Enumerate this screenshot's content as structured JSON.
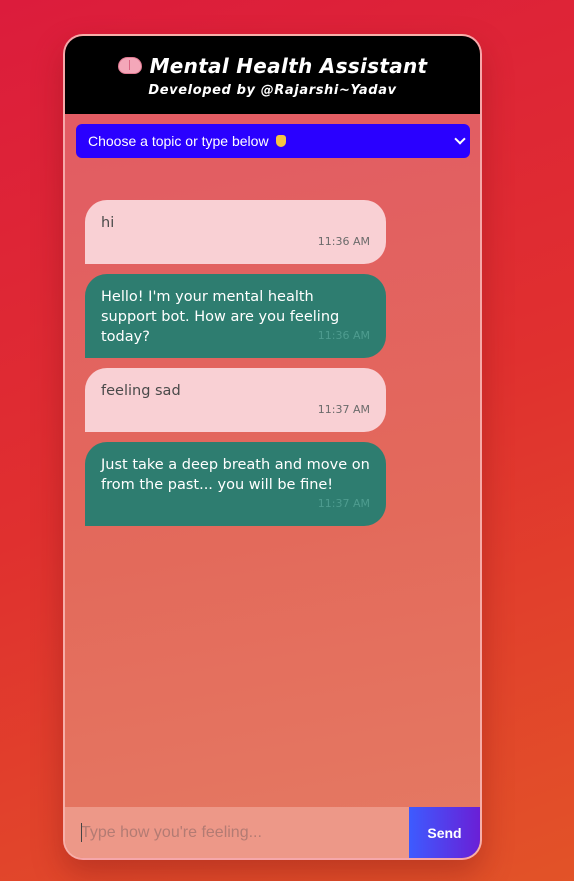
{
  "header": {
    "title": "Mental Health Assistant",
    "subtitle": "Developed by @Rajarshi~Yadav"
  },
  "topic_select": {
    "selected": "Choose a topic or type below"
  },
  "messages": [
    {
      "sender": "user",
      "text": "hi",
      "time": "11:36 AM"
    },
    {
      "sender": "bot",
      "text": "Hello! I'm your mental health support bot. How are you feeling today?",
      "time": "11:36 AM"
    },
    {
      "sender": "user",
      "text": "feeling sad",
      "time": "11:37 AM"
    },
    {
      "sender": "bot",
      "text": "Just take a deep breath and move on from the past... you will be fine!",
      "time": "11:37 AM"
    }
  ],
  "composer": {
    "placeholder": "Type how you're feeling...",
    "value": "",
    "send_label": "Send"
  },
  "icons": {
    "header_icon": "brain-icon",
    "select_icon": "pointing-down-icon",
    "dropdown_icon": "chevron-down-icon"
  },
  "colors": {
    "header_bg": "#000000",
    "select_bg": "#2a00ff",
    "user_bubble": "#f9d0d4",
    "bot_bubble": "#2e7d70",
    "send_gradient_start": "#3d5bff",
    "send_gradient_end": "#6a1fd6"
  }
}
